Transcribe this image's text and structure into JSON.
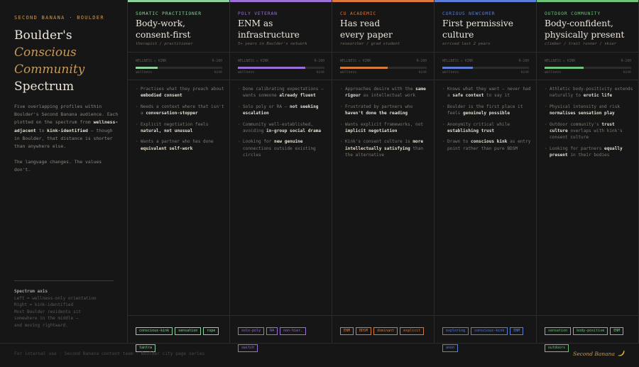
{
  "intro": {
    "kicker": "SECOND BANANA · BOULDER",
    "title": [
      "Boulder's",
      "Conscious",
      "Community",
      "Spectrum"
    ],
    "text": [
      [
        {
          "t": "Five overlapping profiles within Boulder's Second Banana audience. Each plotted on the spectrum from "
        },
        {
          "t": "wellness-adjacent",
          "b": true
        },
        {
          "t": " to "
        },
        {
          "t": "kink-identified",
          "b": true
        },
        {
          "t": " — though in Boulder, that distance is shorter than anywhere else."
        }
      ],
      [
        {
          "t": "The language changes. The values don't."
        }
      ]
    ],
    "axis": {
      "heading": "Spectrum axis",
      "lines": [
        "Left = wellness-only orientation",
        "Right = kink-identified",
        "Most Boulder residents sit",
        "somewhere in the middle —",
        "and moving rightward."
      ]
    }
  },
  "meter": {
    "label_left": "WELLNESS ↔ KINK",
    "label_right": "0–100",
    "end_left": "wellness",
    "end_right": "kink"
  },
  "columns": [
    {
      "category": "SOMATIC PRACTITIONER",
      "title": [
        "Body-work,",
        "consent-first"
      ],
      "subtitle": "therapist / practitioner",
      "color": "#8fd19e",
      "meter_value": 0.25,
      "bullets": [
        [
          {
            "t": "Practises what they preach about "
          },
          {
            "t": "embodied consent",
            "b": true
          }
        ],
        [
          {
            "t": "Needs a context where that isn't a "
          },
          {
            "t": "conversation-stopper",
            "b": true
          }
        ],
        [
          {
            "t": "Explicit negotiation feels "
          },
          {
            "t": "natural, not unusual",
            "b": true
          }
        ],
        [
          {
            "t": "Wants a partner who has done "
          },
          {
            "t": "equivalent self-work",
            "b": true
          }
        ]
      ],
      "tags": [
        "conscious-kink",
        "sensation",
        "rope",
        "tantra"
      ]
    },
    {
      "category": "POLY VETERAN",
      "title": [
        "ENM as",
        "infrastructure"
      ],
      "subtitle": "5+ years in Boulder's network",
      "color": "#9a6fd6",
      "meter_value": 0.78,
      "bullets": [
        [
          {
            "t": "Done calibrating expectations — wants someone "
          },
          {
            "t": "already fluent",
            "b": true
          }
        ],
        [
          {
            "t": "Solo poly or RA — "
          },
          {
            "t": "not seeking escalation",
            "b": true
          }
        ],
        [
          {
            "t": "Community well-established, avoiding "
          },
          {
            "t": "in-group social drama",
            "b": true
          }
        ],
        [
          {
            "t": "Looking for "
          },
          {
            "t": "new genuine",
            "b": true
          },
          {
            "t": " connections outside existing circles"
          }
        ]
      ],
      "tags": [
        "solo-poly",
        "RA",
        "non-hier.",
        "switch"
      ]
    },
    {
      "category": "CU ACADEMIC",
      "title": [
        "Has read",
        "every paper"
      ],
      "subtitle": "researcher / grad student",
      "color": "#d97a3a",
      "meter_value": 0.55,
      "bullets": [
        [
          {
            "t": "Approaches desire with the "
          },
          {
            "t": "same rigour",
            "b": true
          },
          {
            "t": " as intellectual work"
          }
        ],
        [
          {
            "t": "Frustrated by partners who "
          },
          {
            "t": "haven't done the reading",
            "b": true
          }
        ],
        [
          {
            "t": "Wants explicit frameworks, not "
          },
          {
            "t": "implicit negotiation",
            "b": true
          }
        ],
        [
          {
            "t": "Kink's consent culture is "
          },
          {
            "t": "more intellectually satisfying",
            "b": true
          },
          {
            "t": " than the alternative"
          }
        ]
      ],
      "tags": [
        "ENM",
        "BDSM",
        "dominant",
        "explicit"
      ]
    },
    {
      "category": "CURIOUS NEWCOMER",
      "title": [
        "First permissive",
        "culture"
      ],
      "subtitle": "arrived last 2 years",
      "color": "#5b7fd6",
      "meter_value": 0.35,
      "bullets": [
        [
          {
            "t": "Knows what they want — never had a "
          },
          {
            "t": "safe context",
            "b": true
          },
          {
            "t": " to say it"
          }
        ],
        [
          {
            "t": "Boulder is the first place it feels "
          },
          {
            "t": "genuinely possible",
            "b": true
          }
        ],
        [
          {
            "t": "Anonymity critical while "
          },
          {
            "t": "establishing trust",
            "b": true
          }
        ],
        [
          {
            "t": "Drawn to "
          },
          {
            "t": "conscious kink",
            "b": true
          },
          {
            "t": " as entry point rather than pure BDSM"
          }
        ]
      ],
      "tags": [
        "exploring",
        "conscious-kink",
        "ENM",
        "anon"
      ]
    },
    {
      "category": "OUTDOOR COMMUNITY",
      "title": [
        "Body-confident,",
        "physically present"
      ],
      "subtitle": "climber / trail runner / skier",
      "color": "#6fc27a",
      "meter_value": 0.45,
      "bullets": [
        [
          {
            "t": "Athletic body-positivity extends naturally to "
          },
          {
            "t": "erotic life",
            "b": true
          }
        ],
        [
          {
            "t": "Physical intensity and risk "
          },
          {
            "t": "normalises sensation play",
            "b": true
          }
        ],
        [
          {
            "t": "Outdoor community's "
          },
          {
            "t": "trust culture",
            "b": true
          },
          {
            "t": " overlaps with kink's consent culture"
          }
        ],
        [
          {
            "t": "Looking for partners "
          },
          {
            "t": "equally present",
            "b": true
          },
          {
            "t": " in their bodies"
          }
        ]
      ],
      "tags": [
        "sensation",
        "body-positive",
        "ENM",
        "outdoors"
      ]
    }
  ],
  "footer": {
    "text": "For internal use · Second Banana content team · Boulder city page series",
    "brand": "Second Banana"
  }
}
